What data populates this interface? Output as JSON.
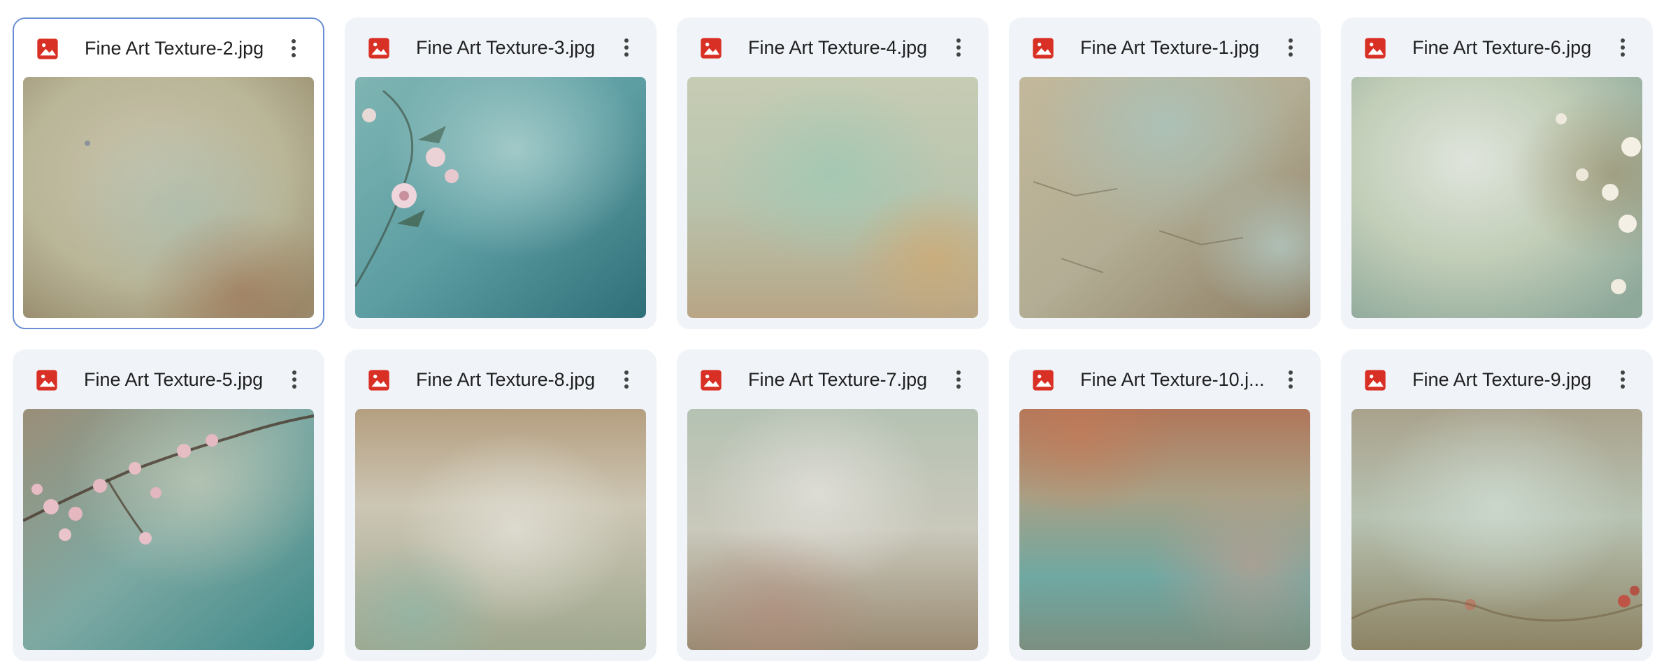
{
  "files": [
    {
      "name": "Fine Art Texture-2.jpg",
      "selected": true,
      "thumbnail": "warm-beige-mottled-texture"
    },
    {
      "name": "Fine Art Texture-3.jpg",
      "selected": false,
      "thumbnail": "teal-texture-with-pink-roses"
    },
    {
      "name": "Fine Art Texture-4.jpg",
      "selected": false,
      "thumbnail": "pale-green-golden-texture"
    },
    {
      "name": "Fine Art Texture-1.jpg",
      "selected": false,
      "thumbnail": "cracked-beige-teal-texture"
    },
    {
      "name": "Fine Art Texture-6.jpg",
      "selected": false,
      "thumbnail": "soft-green-texture-with-white-flowers"
    },
    {
      "name": "Fine Art Texture-5.jpg",
      "selected": false,
      "thumbnail": "teal-texture-with-cherry-blossom-branch"
    },
    {
      "name": "Fine Art Texture-8.jpg",
      "selected": false,
      "thumbnail": "cream-teal-floral-texture"
    },
    {
      "name": "Fine Art Texture-7.jpg",
      "selected": false,
      "thumbnail": "misty-grey-green-floral-texture"
    },
    {
      "name": "Fine Art Texture-10.j...",
      "selected": false,
      "thumbnail": "rust-and-teal-texture"
    },
    {
      "name": "Fine Art Texture-9.jpg",
      "selected": false,
      "thumbnail": "misty-green-texture-with-red-flowers"
    }
  ],
  "icons": {
    "file_type": "image-file-icon",
    "more": "more-options-icon"
  },
  "colors": {
    "file_icon": "#d93025",
    "card_bg": "#f0f4f9",
    "selected_border": "#6b8fd4"
  }
}
